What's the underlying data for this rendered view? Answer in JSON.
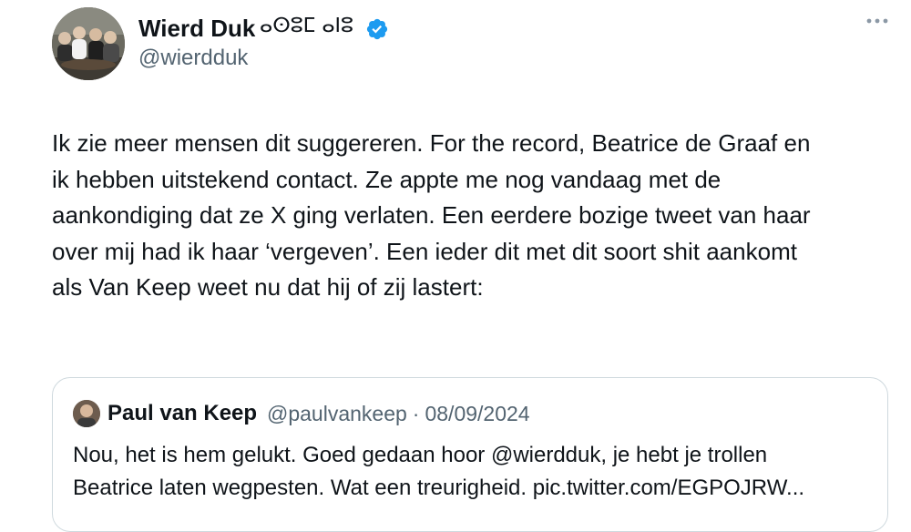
{
  "tweet": {
    "author": {
      "name": "Wierd Duk",
      "name_script": "ⴰⵙⵓⵎ ⴰⵏⵓ",
      "handle": "@wierdduk",
      "verified": true
    },
    "text": "Ik zie meer mensen dit suggereren. For the record, Beatrice de Graaf en\nik hebben uitstekend contact. Ze appte me nog vandaag met de\naankondiging dat ze X ging verlaten. Een eerdere bozige tweet van haar\nover mij had ik haar ‘vergeven’. Een ieder dit met dit soort shit aankomt\nals Van Keep weet nu dat hij of zij lastert:"
  },
  "quoted_tweet": {
    "author_name": "Paul van Keep",
    "handle": "@paulvankeep",
    "separator": "·",
    "date": "08/09/2024",
    "text": "Nou, het is hem gelukt. Goed gedaan hoor @wierdduk, je hebt je trollen\nBeatrice laten wegpesten. Wat een treurigheid. pic.twitter.com/EGPOJRW..."
  },
  "icons": {
    "verified": "verified-badge-icon",
    "more": "more-horizontal-icon"
  },
  "colors": {
    "text": "#0f1419",
    "secondary": "#536471",
    "verified": "#1d9bf0",
    "border": "#cfd9de"
  }
}
